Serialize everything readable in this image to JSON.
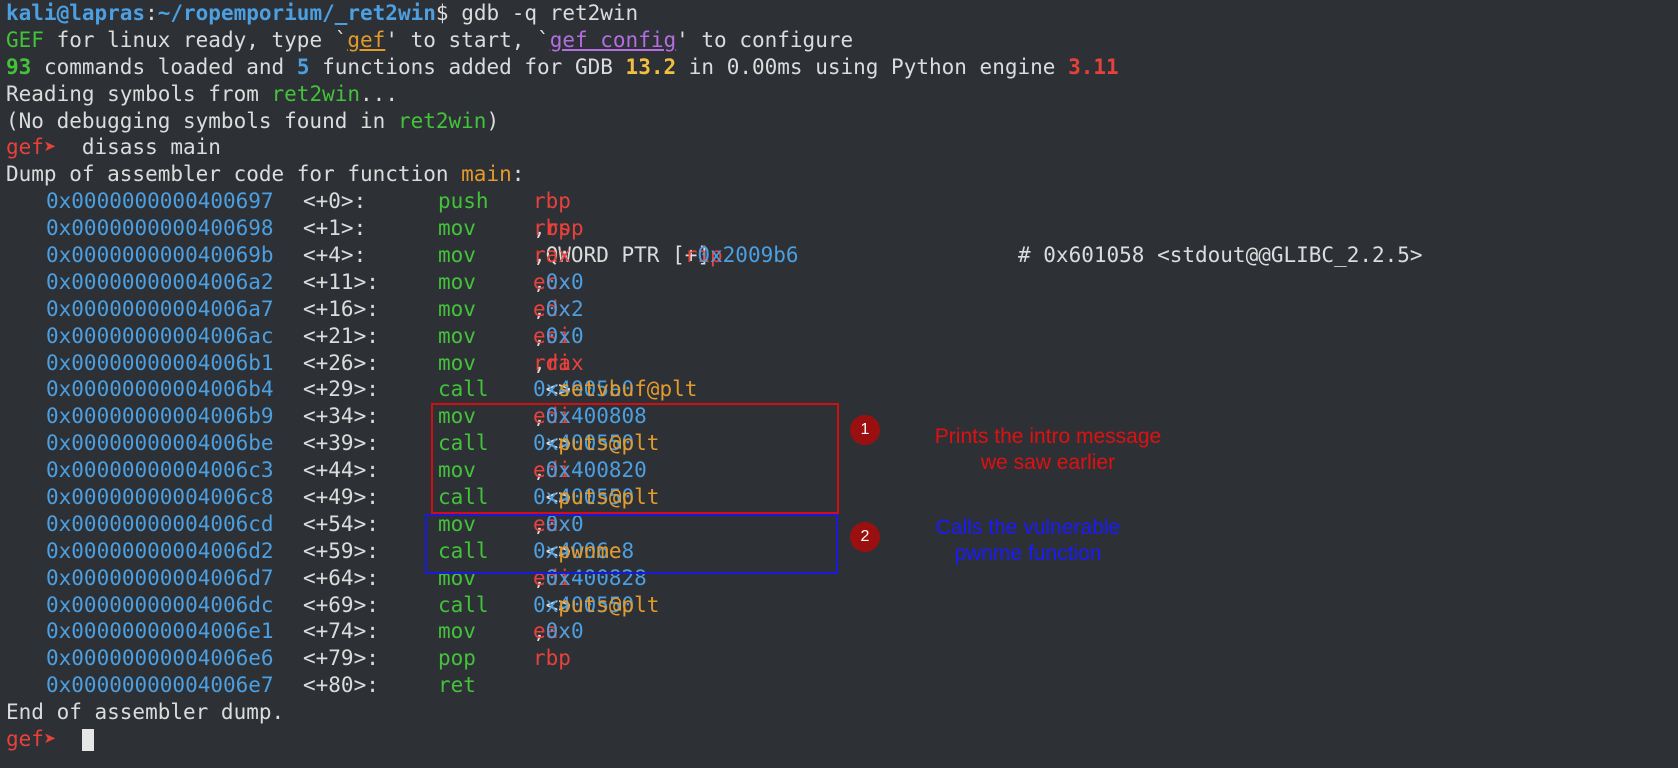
{
  "header": {
    "prompt_user": "kali@lapras",
    "prompt_sep": ":",
    "prompt_path": "~/ropemporium/_ret2win",
    "prompt_sym": "$",
    "command": " gdb -q ret2win"
  },
  "gef": {
    "line1_a": "GEF",
    "line1_b": " for linux ready, type `",
    "line1_gef": "gef",
    "line1_c": "' to start, `",
    "line1_gef_config": "gef config",
    "line1_d": "' to configure",
    "line2_count": "93",
    "line2_a": " commands loaded and ",
    "line2_fn": "5",
    "line2_b": " functions added for GDB ",
    "line2_gdb": "13.2",
    "line2_c": " in 0.00ms using Python engine ",
    "line2_py": "3.11",
    "reading_a": "Reading symbols from ",
    "reading_file": "ret2win",
    "reading_b": "...",
    "nodebug_a": "(No debugging symbols found in ",
    "nodebug_file": "ret2win",
    "nodebug_b": ")",
    "prompt": "gef➤",
    "cmd": "  disass main",
    "dump_a": "Dump of assembler code for function ",
    "dump_fn": "main",
    "dump_b": ":",
    "end": "End of assembler dump."
  },
  "disasm": [
    {
      "addr": "0x0000000000400697",
      "off": "<+0>:",
      "mn": "push",
      "op": "rbp"
    },
    {
      "addr": "0x0000000000400698",
      "off": "<+1>:",
      "mn": "mov",
      "op": "rbp,rsp"
    },
    {
      "addr": "0x000000000040069b",
      "off": "<+4>:",
      "mn": "mov",
      "op": "rax,QWORD PTR [rip+0x2009b6]",
      "comment": "# 0x601058 <stdout@@GLIBC_2.2.5>"
    },
    {
      "addr": "0x00000000004006a2",
      "off": "<+11>:",
      "mn": "mov",
      "op": "ecx,0x0"
    },
    {
      "addr": "0x00000000004006a7",
      "off": "<+16>:",
      "mn": "mov",
      "op": "edx,0x2"
    },
    {
      "addr": "0x00000000004006ac",
      "off": "<+21>:",
      "mn": "mov",
      "op": "esi,0x0"
    },
    {
      "addr": "0x00000000004006b1",
      "off": "<+26>:",
      "mn": "mov",
      "op": "rdi,rax"
    },
    {
      "addr": "0x00000000004006b4",
      "off": "<+29>:",
      "mn": "call",
      "op": "0x4005a0 <setvbuf@plt>"
    },
    {
      "addr": "0x00000000004006b9",
      "off": "<+34>:",
      "mn": "mov",
      "op": "edi,0x400808"
    },
    {
      "addr": "0x00000000004006be",
      "off": "<+39>:",
      "mn": "call",
      "op": "0x400550 <puts@plt>"
    },
    {
      "addr": "0x00000000004006c3",
      "off": "<+44>:",
      "mn": "mov",
      "op": "edi,0x400820"
    },
    {
      "addr": "0x00000000004006c8",
      "off": "<+49>:",
      "mn": "call",
      "op": "0x400550 <puts@plt>"
    },
    {
      "addr": "0x00000000004006cd",
      "off": "<+54>:",
      "mn": "mov",
      "op": "eax,0x0"
    },
    {
      "addr": "0x00000000004006d2",
      "off": "<+59>:",
      "mn": "call",
      "op": "0x4006e8 <pwnme>"
    },
    {
      "addr": "0x00000000004006d7",
      "off": "<+64>:",
      "mn": "mov",
      "op": "edi,0x400828"
    },
    {
      "addr": "0x00000000004006dc",
      "off": "<+69>:",
      "mn": "call",
      "op": "0x400550 <puts@plt>"
    },
    {
      "addr": "0x00000000004006e1",
      "off": "<+74>:",
      "mn": "mov",
      "op": "eax,0x0"
    },
    {
      "addr": "0x00000000004006e6",
      "off": "<+79>:",
      "mn": "pop",
      "op": "rbp"
    },
    {
      "addr": "0x00000000004006e7",
      "off": "<+80>:",
      "mn": "ret",
      "op": ""
    }
  ],
  "annotations": [
    {
      "badge": "1",
      "note": "Prints the intro message\nwe saw earlier",
      "color": "#e01010"
    },
    {
      "badge": "2",
      "note": "Calls the vulnerable\npwnme function",
      "color": "#1a1aff"
    }
  ],
  "colors": {
    "background": "#2d3136",
    "address": "#4c9fe0",
    "mnemonic": "#43c23a",
    "register": "#e8413c",
    "symbol": "#e49a2a"
  }
}
